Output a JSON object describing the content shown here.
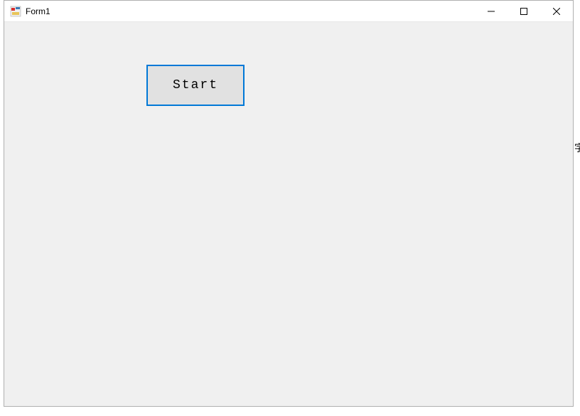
{
  "window": {
    "title": "Form1"
  },
  "controls": {
    "start_label": "Start"
  },
  "outside": {
    "glyph": "字"
  }
}
